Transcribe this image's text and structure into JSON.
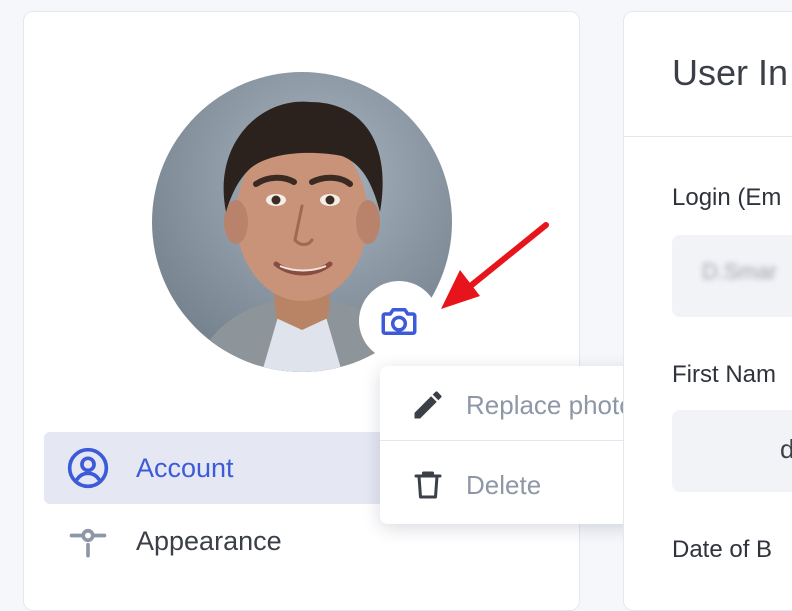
{
  "profile": {
    "camera_icon": "camera-icon",
    "menu": {
      "items": [
        {
          "label": "Replace photo",
          "icon": "pencil-icon"
        },
        {
          "label": "Delete",
          "icon": "trash-icon"
        }
      ]
    },
    "nav": [
      {
        "label": "Account",
        "icon": "user-circle-icon",
        "active": true
      },
      {
        "label": "Appearance",
        "icon": "slider-icon",
        "active": false
      }
    ]
  },
  "user_info": {
    "title": "User In",
    "login_label": "Login (Em",
    "login_value": "D.Smar",
    "first_name_label": "First Nam",
    "first_name_value": "d",
    "dob_label": "Date of B"
  },
  "colors": {
    "accent": "#3d5bd9",
    "annotation_arrow": "#e8141c"
  }
}
